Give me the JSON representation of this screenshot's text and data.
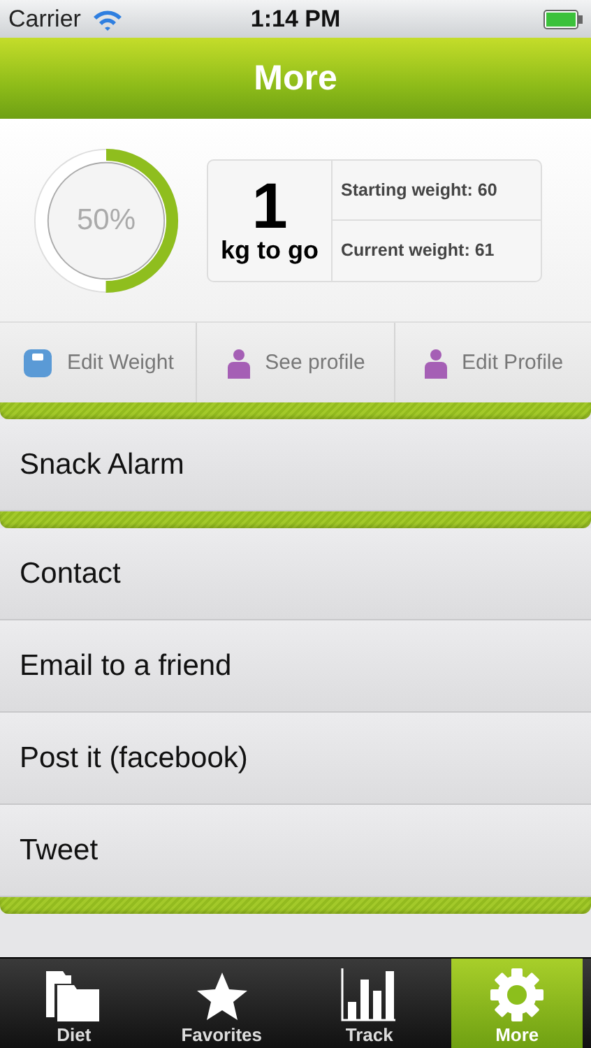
{
  "status_bar": {
    "carrier": "Carrier",
    "time": "1:14 PM"
  },
  "header": {
    "title": "More"
  },
  "progress": {
    "level": 0.5,
    "label": "50%"
  },
  "goal": {
    "amount": "1",
    "unit": "kg to go",
    "starting": "Starting weight: 60",
    "current": "Current weight: 61"
  },
  "actions": [
    {
      "label": "Edit Weight",
      "kind": "scale"
    },
    {
      "label": "See profile",
      "kind": "person"
    },
    {
      "label": "Edit Profile",
      "kind": "person"
    }
  ],
  "sections": [
    {
      "items": [
        "Snack Alarm"
      ]
    },
    {
      "items": [
        "Contact",
        "Email to a friend",
        "Post it (facebook)",
        "Tweet"
      ]
    }
  ],
  "tabs": [
    {
      "label": "Diet",
      "kind": "folder",
      "selected": false
    },
    {
      "label": "Favorites",
      "kind": "star",
      "selected": false
    },
    {
      "label": "Track",
      "kind": "chart",
      "selected": false
    },
    {
      "label": "More",
      "kind": "gear",
      "selected": true
    }
  ]
}
